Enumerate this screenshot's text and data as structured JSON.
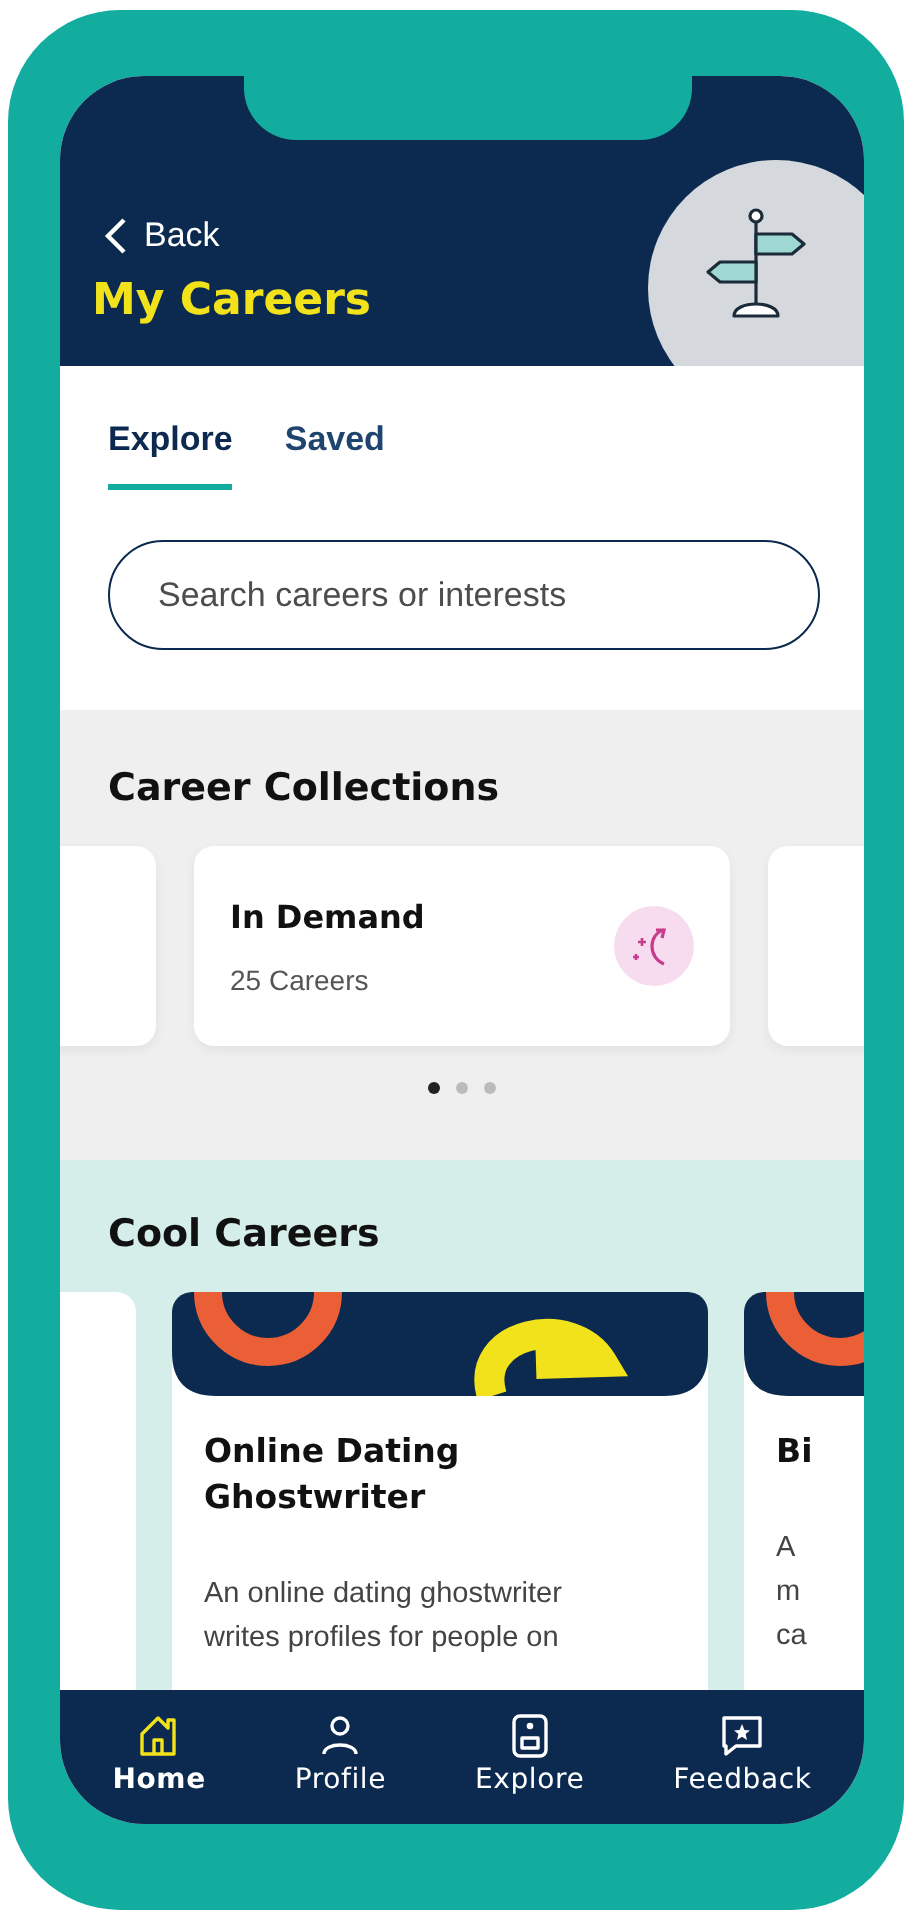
{
  "header": {
    "back": "Back",
    "title": "My Careers"
  },
  "tabs": [
    {
      "label": "Explore",
      "selected": true
    },
    {
      "label": "Saved",
      "selected": false
    }
  ],
  "search": {
    "placeholder": "Search careers or interests"
  },
  "collections": {
    "title": "Career Collections",
    "cards": [
      {
        "title": "In Demand",
        "count": "25 Careers"
      }
    ],
    "pages": [
      {
        "selected": true
      },
      {
        "selected": false
      },
      {
        "selected": false
      }
    ]
  },
  "cool_careers": {
    "title": "Cool Careers",
    "cards": [
      {
        "title": "Online Dating Ghostwriter",
        "description": [
          "An online dating ghostwriter",
          "writes profiles for people on"
        ]
      },
      {
        "title": "Bi",
        "description": [
          "A",
          "m",
          "ca"
        ]
      }
    ]
  },
  "nav": [
    {
      "label": "Home",
      "kind": "home",
      "selected": true
    },
    {
      "label": "Profile",
      "kind": "profile",
      "selected": false
    },
    {
      "label": "Explore",
      "kind": "explore",
      "selected": false
    },
    {
      "label": "Feedback",
      "kind": "feedback",
      "selected": false
    }
  ]
}
